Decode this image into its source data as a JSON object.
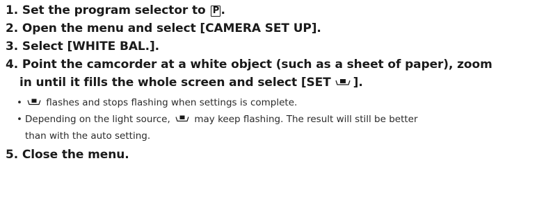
{
  "steps": {
    "s1": {
      "num": "1.",
      "text": "Set the program selector to",
      "end": ".",
      "mode_glyph": "P"
    },
    "s2": {
      "num": "2.",
      "text": "Open the menu and select [CAMERA SET UP]."
    },
    "s3": {
      "num": "3.",
      "text": "Select [WHITE BAL.]."
    },
    "s4": {
      "num": "4.",
      "line1": "Point the camcorder at a white object (such as a sheet of paper), zoom",
      "line2_pre": "in until it fills the whole screen and select [SET",
      "line2_post": "]."
    },
    "s5": {
      "num": "5.",
      "text": "Close the menu."
    }
  },
  "bullets": [
    {
      "dot": "•",
      "pre": "",
      "post": "flashes and stops flashing when settings is complete."
    },
    {
      "dot": "•",
      "pre": "Depending on the light source,",
      "post": "may keep flashing. The result will still be better",
      "cont": "than with the auto setting."
    }
  ],
  "icons": {
    "mode": "program-mode-P-icon",
    "wb": "custom-white-balance-icon"
  }
}
